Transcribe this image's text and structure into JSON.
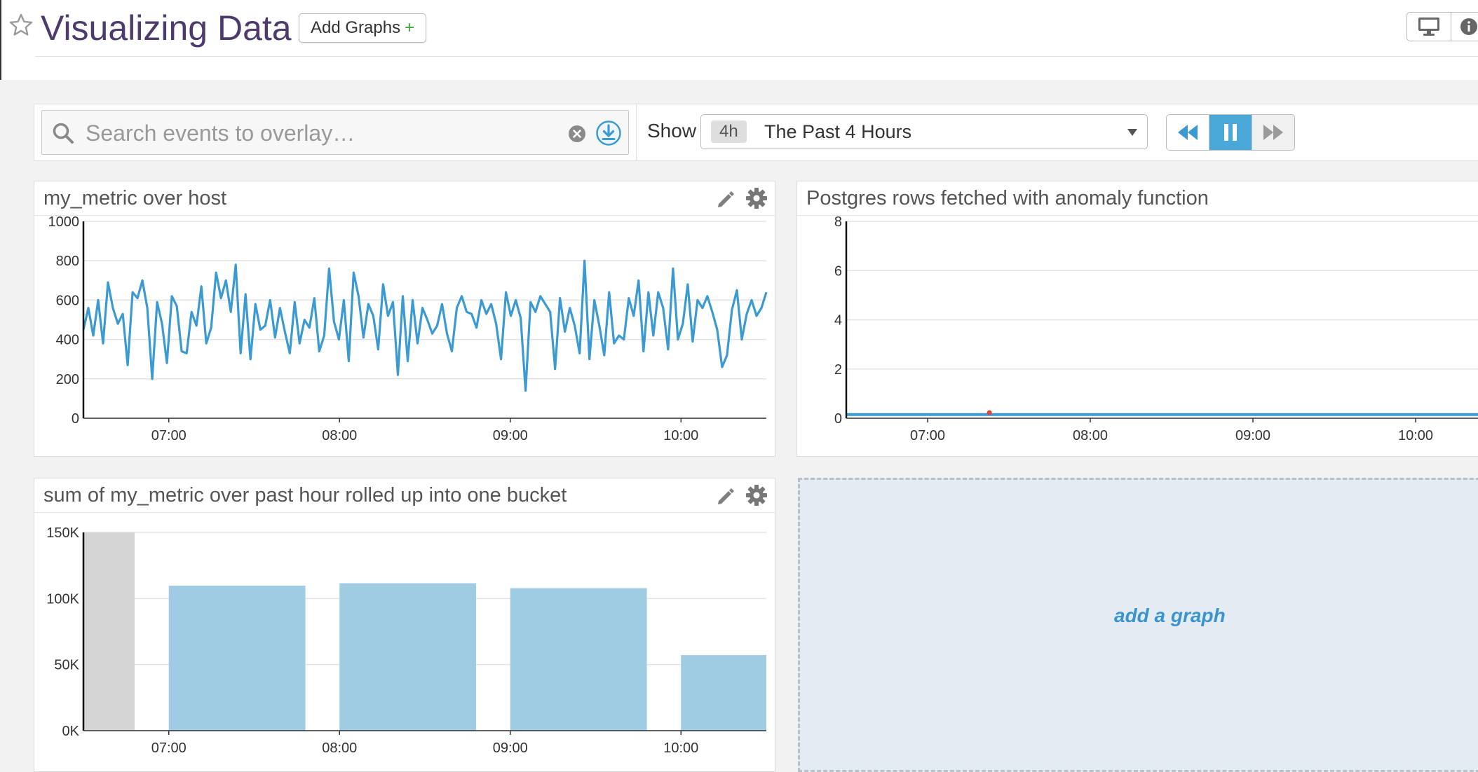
{
  "header": {
    "title": "Visualizing Data",
    "add_graphs_label": "Add Graphs",
    "add_graphs_plus": "+"
  },
  "controls": {
    "search_placeholder": "Search events to overlay…",
    "show_label": "Show",
    "time_badge": "4h",
    "time_range": "The Past 4 Hours"
  },
  "colors": {
    "title": "#4d3b6e",
    "series_line": "#3a9ad1",
    "bar": "#9fcbe3",
    "bar_partial": "#d5d5d5",
    "anomaly_point": "#e0453a",
    "link": "#3a95cf"
  },
  "add_graph": {
    "label": "add a graph"
  },
  "widgets": [
    {
      "title": "my_metric over host"
    },
    {
      "title": "Postgres rows fetched with anomaly function"
    },
    {
      "title": "sum of my_metric over past hour rolled up into one bucket"
    }
  ],
  "chart_data": [
    {
      "type": "line",
      "title": "my_metric over host",
      "x_ticks": [
        "07:00",
        "08:00",
        "09:00",
        "10:00"
      ],
      "x_range_hours": [
        6.5,
        10.5
      ],
      "ylim": [
        0,
        1000
      ],
      "y_ticks": [
        "0",
        "200",
        "400",
        "600",
        "800",
        "1000"
      ],
      "grid": true,
      "series": [
        {
          "values": [
            450,
            560,
            420,
            600,
            380,
            690,
            560,
            480,
            530,
            270,
            640,
            610,
            700,
            560,
            200,
            590,
            480,
            280,
            620,
            570,
            340,
            330,
            540,
            470,
            670,
            380,
            460,
            740,
            610,
            700,
            540,
            780,
            330,
            630,
            300,
            580,
            450,
            470,
            600,
            410,
            560,
            440,
            330,
            590,
            380,
            500,
            460,
            610,
            340,
            420,
            760,
            490,
            400,
            600,
            290,
            740,
            620,
            410,
            580,
            520,
            350,
            680,
            520,
            590,
            220,
            620,
            290,
            600,
            380,
            560,
            500,
            430,
            470,
            580,
            430,
            340,
            560,
            620,
            540,
            530,
            460,
            600,
            530,
            580,
            480,
            300,
            640,
            520,
            600,
            510,
            140,
            590,
            540,
            620,
            580,
            540,
            250,
            610,
            440,
            560,
            470,
            330,
            800,
            300,
            600,
            470,
            320,
            640,
            380,
            420,
            400,
            610,
            520,
            700,
            340,
            640,
            420,
            640,
            560,
            350,
            760,
            400,
            480,
            680,
            390,
            600,
            560,
            620,
            540,
            450,
            260,
            320,
            550,
            650,
            400,
            530,
            600,
            520,
            560,
            640
          ]
        }
      ]
    },
    {
      "type": "line",
      "title": "Postgres rows fetched with anomaly function",
      "x_ticks": [
        "07:00",
        "08:00",
        "09:00",
        "10:00"
      ],
      "x_range_hours": [
        6.5,
        10.5
      ],
      "ylim": [
        0,
        8
      ],
      "y_ticks": [
        "0",
        "2",
        "4",
        "6",
        "8"
      ],
      "grid": true,
      "series": [
        {
          "x_hours": [
            6.5,
            10.5
          ],
          "values": [
            0.15,
            0.15
          ]
        }
      ],
      "anomalies": [
        {
          "x_hours": 7.38,
          "value": 0.2
        }
      ]
    },
    {
      "type": "bar",
      "title": "sum of my_metric over past hour rolled up into one bucket",
      "x_ticks": [
        "07:00",
        "08:00",
        "09:00",
        "10:00"
      ],
      "x_range_hours": [
        6.5,
        10.5
      ],
      "ylim": [
        0,
        160000
      ],
      "y_ticks": [
        "0K",
        "50K",
        "100K",
        "150K"
      ],
      "grid": true,
      "bars": [
        {
          "start_hours": 6.5,
          "end_hours": 6.8,
          "value": 160000,
          "partial": true
        },
        {
          "start_hours": 7.0,
          "end_hours": 7.8,
          "value": 117000
        },
        {
          "start_hours": 8.0,
          "end_hours": 8.8,
          "value": 119000
        },
        {
          "start_hours": 9.0,
          "end_hours": 9.8,
          "value": 115000
        },
        {
          "start_hours": 10.0,
          "end_hours": 10.5,
          "value": 61000
        }
      ]
    }
  ]
}
